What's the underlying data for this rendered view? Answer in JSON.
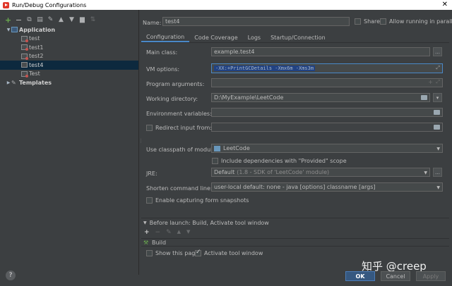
{
  "window": {
    "title": "Run/Debug Configurations",
    "close": "✕"
  },
  "toolbar": {
    "add": "+",
    "remove": "−",
    "copy": "⧉",
    "save": "▤",
    "edit": "✎",
    "up": "▲",
    "down": "▼",
    "folder": "▆",
    "sort": "⇅"
  },
  "tree": {
    "application_label": "Application",
    "items": [
      "test",
      "test1",
      "test2",
      "test4",
      "Test"
    ],
    "selected_index": 3,
    "templates_label": "Templates"
  },
  "form": {
    "name_label": "Name:",
    "name_value": "test4",
    "share_label": "Share",
    "allow_parallel_label": "Allow running in parallel",
    "tabs": [
      "Configuration",
      "Code Coverage",
      "Logs",
      "Startup/Connection"
    ],
    "main_class_label": "Main class:",
    "main_class_value": "example.test4",
    "vm_options_label": "VM options:",
    "vm_options_value": "-XX:+PrintGCDetails -Xmx6m -Xms3m",
    "program_args_label": "Program arguments:",
    "working_dir_label": "Working directory:",
    "working_dir_value": "D:\\MyExample\\LeetCode",
    "env_vars_label": "Environment variables:",
    "redirect_input_label": "Redirect input from:",
    "classpath_label": "Use classpath of module:",
    "classpath_value": "LeetCode",
    "include_provided_label": "Include dependencies with \"Provided\" scope",
    "jre_label": "JRE:",
    "jre_value_main": "Default",
    "jre_value_detail": "(1.8 - SDK of 'LeetCode' module)",
    "shorten_label": "Shorten command line:",
    "shorten_value": "user-local default: none - java [options] classname [args]",
    "snapshots_label": "Enable capturing form snapshots",
    "before_launch_label": "Before launch: Build, Activate tool window",
    "build_label": "Build",
    "show_page_label": "Show this page",
    "activate_window_label": "Activate tool window"
  },
  "buttons": {
    "ok": "OK",
    "cancel": "Cancel",
    "apply": "Apply",
    "help": "?"
  },
  "watermark": "知乎 @creep",
  "colors": {
    "background": "#3c3f41",
    "selection": "#0d293e",
    "accent": "#4a88c7",
    "ok": "#365880"
  }
}
